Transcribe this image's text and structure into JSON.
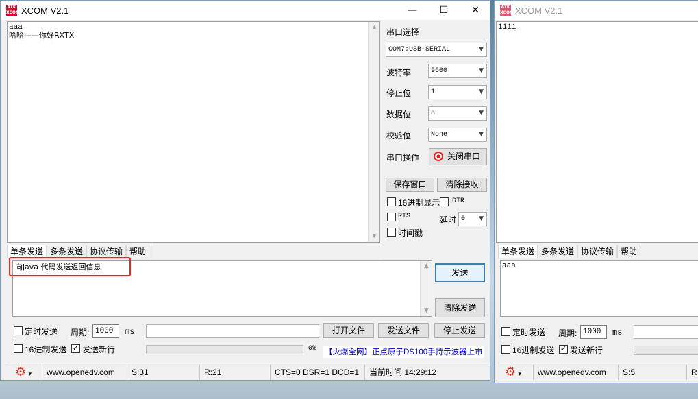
{
  "main_window": {
    "title": "XCOM V2.1",
    "logo_text": "ATK XCOM",
    "controls": {
      "minimize": "—",
      "maximize": "☐",
      "close": "✕"
    },
    "receive_text": [
      "aaa",
      "哈哈——你好RXTX"
    ],
    "serial_panel": {
      "port_select_label": "串口选择",
      "port_value": "COM7:USB-SERIAL",
      "baud_label": "波特率",
      "baud_value": "9600",
      "stopbit_label": "停止位",
      "stopbit_value": "1",
      "databit_label": "数据位",
      "databit_value": "8",
      "parity_label": "校验位",
      "parity_value": "None",
      "port_op_label": "串口操作",
      "close_port_label": "关闭串口",
      "save_window_label": "保存窗口",
      "clear_receive_label": "清除接收",
      "hex_display_label": "16进制显示",
      "dtr_label": "DTR",
      "rts_label": "RTS",
      "delay_label": "延时",
      "delay_value": "0",
      "timestamp_label": "时间戳"
    },
    "tabs": [
      "单条发送",
      "多条发送",
      "协议传输",
      "帮助"
    ],
    "send_text": "向java 代码发送返回信息",
    "send_label": "发送",
    "clear_send_label": "清除发送",
    "timed_send_label": "定时发送",
    "period_label": "周期:",
    "period_value": "1000",
    "ms_label": "ms",
    "open_file_label": "打开文件",
    "send_file_label": "发送文件",
    "stop_send_label": "停止发送",
    "hex_send_label": "16进制发送",
    "send_newline_label": "发送新行",
    "progress_percent": "0%",
    "ad_text": "【火爆全网】正点原子DS100手持示波器上市",
    "highlight_color": "#e8241c",
    "status": {
      "website": "www.openedv.com",
      "sent": "S:31",
      "received": "R:21",
      "signals": "CTS=0 DSR=1 DCD=1",
      "time": "当前时间 14:29:12"
    }
  },
  "second_window": {
    "title": "XCOM V2.1",
    "logo_text": "ATK XCOM",
    "receive_text": "1111",
    "tabs": [
      "单条发送",
      "多条发送",
      "协议传输",
      "帮助"
    ],
    "send_text": "aaa",
    "timed_send_label": "定时发送",
    "period_label": "周期:",
    "period_value": "1000",
    "ms_label": "ms",
    "hex_send_label": "16进制发送",
    "send_newline_label": "发送新行",
    "status": {
      "website": "www.openedv.com",
      "sent": "S:5",
      "received": "R"
    }
  }
}
